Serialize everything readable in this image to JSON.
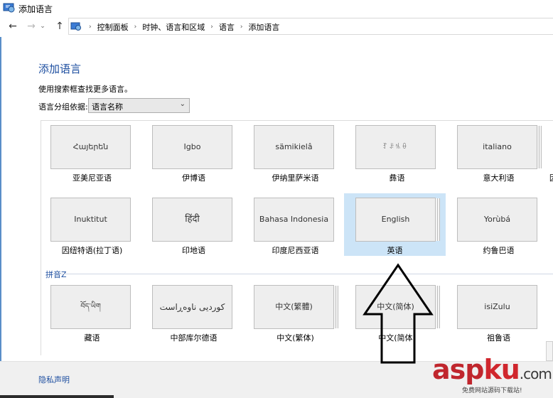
{
  "window": {
    "title": "添加语言"
  },
  "nav": {
    "back": "←",
    "forward": "→",
    "up": "↑"
  },
  "breadcrumb": [
    "控制面板",
    "时钟、语言和区域",
    "语言",
    "添加语言"
  ],
  "page": {
    "heading": "添加语言",
    "hint": "使用搜索框查找更多语言。",
    "group_label": "语言分组依据:",
    "group_value": "语言名称"
  },
  "tiles": [
    {
      "native": "Հայերեն",
      "name": "亚美尼亚语"
    },
    {
      "native": "Igbo",
      "name": "伊博语"
    },
    {
      "native": "sämikielâ",
      "name": "伊纳里萨米语"
    },
    {
      "native": "ꆈꌠꁱꂷ",
      "name": "彝语"
    },
    {
      "native": "italiano",
      "name": "意大利语"
    },
    {
      "native": "",
      "name": "因"
    },
    {
      "native": "Inuktitut",
      "name": "因纽特语(拉丁语)"
    },
    {
      "native": "हिंदी",
      "name": "印地语"
    },
    {
      "native": "Bahasa Indonesia",
      "name": "印度尼西亚语"
    },
    {
      "native": "English",
      "name": "英语",
      "selected": true
    },
    {
      "native": "Yorùbá",
      "name": "约鲁巴语"
    },
    {
      "native": "",
      "name": ""
    },
    {
      "native": "བོད་ཡིག",
      "name": "藏语"
    },
    {
      "native": "کوردیی ناوەڕاست",
      "name": "中部库尔德语"
    },
    {
      "native": "中文(繁體)",
      "name": "中文(繁体)"
    },
    {
      "native": "中文(简体)",
      "name": "中文(简体)"
    },
    {
      "native": "isiZulu",
      "name": "祖鲁语"
    },
    {
      "native": "",
      "name": ""
    }
  ],
  "section": {
    "pinyin": "拼音Z"
  },
  "footer": {
    "privacy": "隐私声明"
  },
  "watermark": {
    "brand_a": "asp",
    "brand_b": "ku",
    "brand_c": ".com",
    "tagline": "免费网站源码下载站!"
  },
  "colors": {
    "accent": "#1e4fa0",
    "selected": "#cce4f7",
    "footer": "#f0f0f0"
  }
}
